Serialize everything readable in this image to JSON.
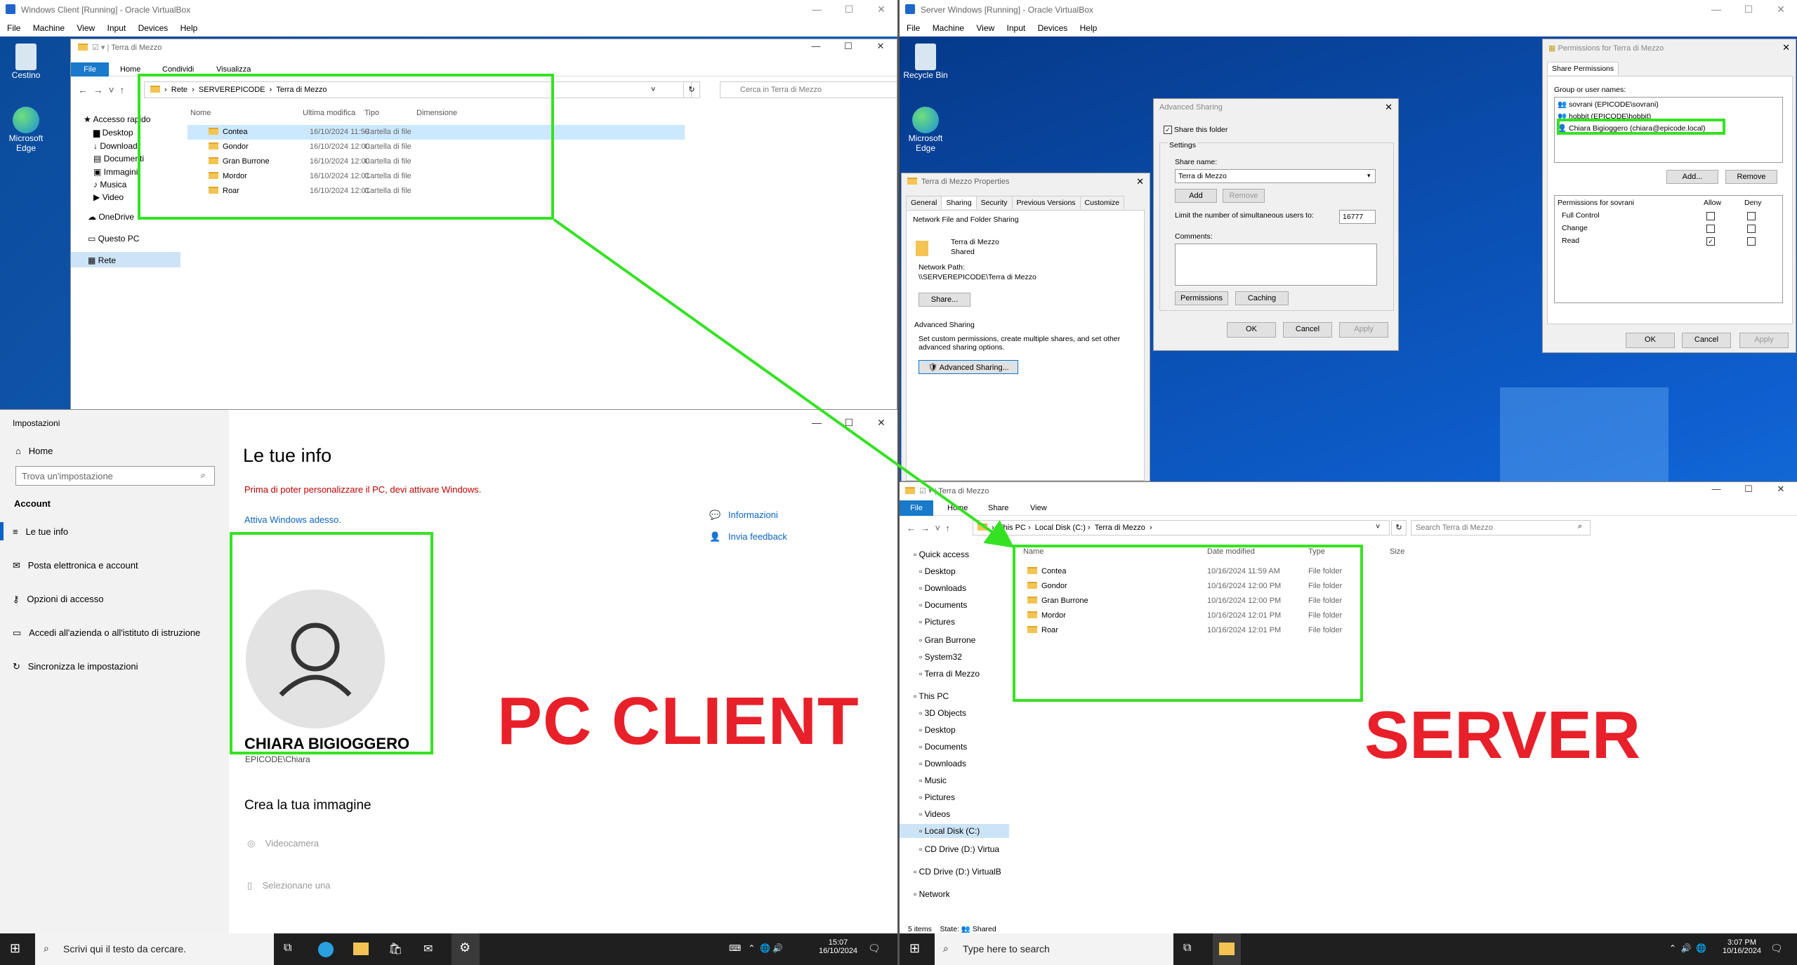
{
  "client": {
    "vb_title": "Windows Client [Running] - Oracle VirtualBox",
    "vb_menu": [
      "File",
      "Machine",
      "View",
      "Input",
      "Devices",
      "Help"
    ],
    "desktop_icons": [
      "Cestino",
      "Microsoft Edge"
    ],
    "explorer": {
      "title": "Terra di Mezzo",
      "ribbon_tabs": [
        "File",
        "Home",
        "Condividi",
        "Visualizza"
      ],
      "path": [
        "Rete",
        "SERVEREPICODE",
        "Terra di Mezzo"
      ],
      "search_placeholder": "Cerca in Terra di Mezzo",
      "columns": [
        "Nome",
        "Ultima modifica",
        "Tipo",
        "Dimensione"
      ],
      "rows": [
        {
          "name": "Contea",
          "date": "16/10/2024 11:59",
          "type": "Cartella di file"
        },
        {
          "name": "Gondor",
          "date": "16/10/2024 12:00",
          "type": "Cartella di file"
        },
        {
          "name": "Gran Burrone",
          "date": "16/10/2024 12:00",
          "type": "Cartella di file"
        },
        {
          "name": "Mordor",
          "date": "16/10/2024 12:01",
          "type": "Cartella di file"
        },
        {
          "name": "Roar",
          "date": "16/10/2024 12:01",
          "type": "Cartella di file"
        }
      ],
      "nav": [
        "Accesso rapido",
        "Desktop",
        "Download",
        "Documenti",
        "Immagini",
        "Musica",
        "Video",
        "OneDrive",
        "Questo PC",
        "Rete"
      ]
    },
    "settings": {
      "app_title": "Impostazioni",
      "home": "Home",
      "search_placeholder": "Trova un'impostazione",
      "section": "Account",
      "menu": [
        "Le tue info",
        "Posta elettronica e account",
        "Opzioni di accesso",
        "Accedi all'azienda o all'istituto di istruzione",
        "Sincronizza le impostazioni"
      ],
      "heading": "Le tue info",
      "warning": "Prima di poter personalizzare il PC, devi attivare Windows.",
      "activate_link": "Attiva Windows adesso.",
      "user_name": "CHIARA BIGIOGGERO",
      "user_account": "EPICODE\\Chiara",
      "create_image": "Crea la tua immagine",
      "camera": "Videocamera",
      "browse": "Selezionane una",
      "side_links": [
        "Informazioni",
        "Invia feedback"
      ]
    },
    "taskbar": {
      "search": "Scrivi qui il testo da cercare.",
      "time": "15:07",
      "date": "16/10/2024"
    },
    "label": "PC CLIENT"
  },
  "server": {
    "vb_title": "Server Windows [Running] - Oracle VirtualBox",
    "vb_menu": [
      "File",
      "Machine",
      "View",
      "Input",
      "Devices",
      "Help"
    ],
    "desktop_icons": [
      "Recycle Bin",
      "Microsoft Edge"
    ],
    "properties": {
      "title": "Terra di Mezzo Properties",
      "tabs": [
        "General",
        "Sharing",
        "Security",
        "Previous Versions",
        "Customize"
      ],
      "group_title": "Network File and Folder Sharing",
      "folder_name": "Terra di Mezzo",
      "folder_state": "Shared",
      "network_path_label": "Network Path:",
      "network_path": "\\\\SERVEREPICODE\\Terra di Mezzo",
      "share_btn": "Share...",
      "adv_title": "Advanced Sharing",
      "adv_desc": "Set custom permissions, create multiple shares, and set other advanced sharing options.",
      "adv_btn": "Advanced Sharing..."
    },
    "advanced": {
      "title": "Advanced Sharing",
      "share_check": "Share this folder",
      "settings": "Settings",
      "share_name_label": "Share name:",
      "share_name": "Terra di Mezzo",
      "add": "Add",
      "remove": "Remove",
      "limit_label": "Limit the number of simultaneous users to:",
      "limit": "16777",
      "comments": "Comments:",
      "permissions": "Permissions",
      "caching": "Caching",
      "ok": "OK",
      "cancel": "Cancel",
      "apply": "Apply"
    },
    "permissions": {
      "title": "Permissions for Terra di Mezzo",
      "tab": "Share Permissions",
      "group_label": "Group or user names:",
      "users": [
        "sovrani (EPICODE\\sovrani)",
        "hobbit (EPICODE\\hobbit)",
        "Chiara Bigioggero (chiara@epicode.local)"
      ],
      "add": "Add...",
      "remove": "Remove",
      "perm_label": "Permissions for sovrani",
      "allow": "Allow",
      "deny": "Deny",
      "perms": [
        {
          "name": "Full Control",
          "allow": false,
          "deny": false
        },
        {
          "name": "Change",
          "allow": false,
          "deny": false
        },
        {
          "name": "Read",
          "allow": true,
          "deny": false
        }
      ],
      "ok": "OK",
      "cancel": "Cancel",
      "apply": "Apply"
    },
    "explorer": {
      "title": "Terra di Mezzo",
      "ribbon_tabs": [
        "File",
        "Home",
        "Share",
        "View"
      ],
      "path": [
        "This PC",
        "Local Disk (C:)",
        "Terra di Mezzo"
      ],
      "search_placeholder": "Search Terra di Mezzo",
      "columns": [
        "Name",
        "Date modified",
        "Type",
        "Size"
      ],
      "rows": [
        {
          "name": "Contea",
          "date": "10/16/2024 11:59 AM",
          "type": "File folder"
        },
        {
          "name": "Gondor",
          "date": "10/16/2024 12:00 PM",
          "type": "File folder"
        },
        {
          "name": "Gran Burrone",
          "date": "10/16/2024 12:00 PM",
          "type": "File folder"
        },
        {
          "name": "Mordor",
          "date": "10/16/2024 12:01 PM",
          "type": "File folder"
        },
        {
          "name": "Roar",
          "date": "10/16/2024 12:01 PM",
          "type": "File folder"
        }
      ],
      "nav": [
        "Quick access",
        "Desktop",
        "Downloads",
        "Documents",
        "Pictures",
        "Gran Burrone",
        "System32",
        "Terra di Mezzo",
        "This PC",
        "3D Objects",
        "Desktop",
        "Documents",
        "Downloads",
        "Music",
        "Pictures",
        "Videos",
        "Local Disk (C:)",
        "CD Drive (D:) Virtua",
        "CD Drive (D:) VirtualB",
        "Network"
      ],
      "status_items": "5 items",
      "status_state": "State:",
      "status_shared": "Shared"
    },
    "taskbar": {
      "search": "Type here to search",
      "time": "3:07 PM",
      "date": "10/16/2024"
    },
    "label": "SERVER"
  },
  "colors": {
    "highlight": "#35e223",
    "label": "#e8202a",
    "accent": "#0a64c8"
  }
}
